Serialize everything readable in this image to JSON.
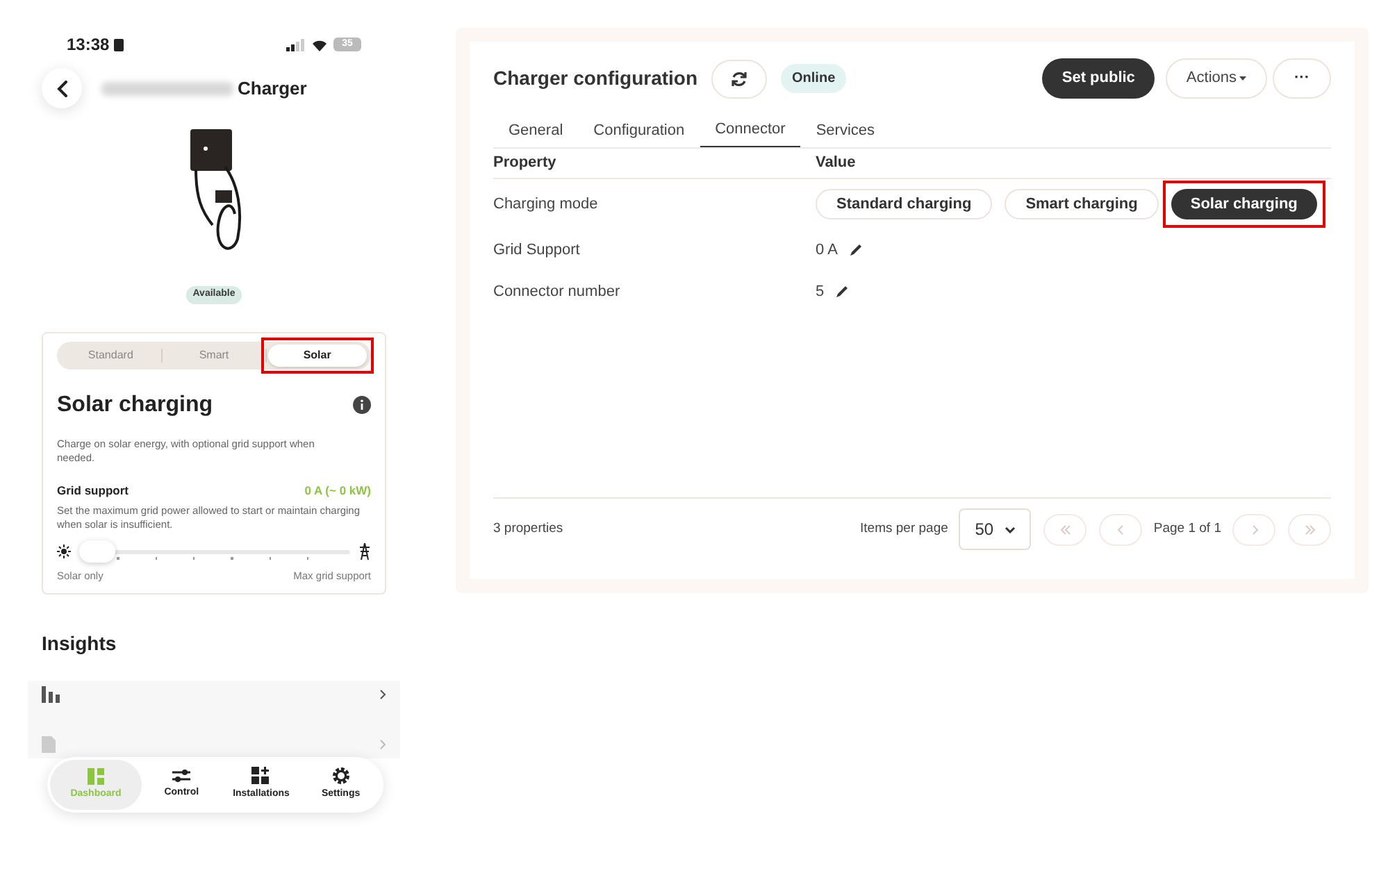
{
  "phone": {
    "status_bar": {
      "time": "13:38",
      "battery": "35"
    },
    "header": {
      "title": "Charger"
    },
    "charger": {
      "status": "Available"
    },
    "mode_tabs": [
      {
        "label": "Standard",
        "selected": false,
        "highlighted": false
      },
      {
        "label": "Smart",
        "selected": false,
        "highlighted": false
      },
      {
        "label": "Solar",
        "selected": true,
        "highlighted": true
      }
    ],
    "mode_card": {
      "title": "Solar charging",
      "description": "Charge on solar energy, with optional grid support when needed.",
      "grid_support": {
        "label": "Grid support",
        "reading": "0 A (~ 0 kW)",
        "hint": "Set the maximum grid power allowed to start or maintain charging when solar is insufficient.",
        "level": 0,
        "min_label": "Solar only",
        "max_label": "Max grid support"
      }
    },
    "insights": {
      "title": "Insights"
    },
    "bottom_nav": [
      {
        "label": "Dashboard",
        "kind": "dashboard",
        "selected": true
      },
      {
        "label": "Control",
        "kind": "control",
        "selected": false
      },
      {
        "label": "Installations",
        "kind": "installations",
        "selected": false
      },
      {
        "label": "Settings",
        "kind": "settings",
        "selected": false
      }
    ]
  },
  "config": {
    "title": "Charger configuration",
    "status": "Online",
    "buttons": {
      "primary": "Set public",
      "actions": "Actions",
      "more": "···"
    },
    "tabs": [
      {
        "label": "General",
        "selected": false
      },
      {
        "label": "Configuration",
        "selected": false
      },
      {
        "label": "Connector",
        "selected": true
      },
      {
        "label": "Services",
        "selected": false
      }
    ],
    "table": {
      "columns": [
        "Property",
        "Value"
      ],
      "rows": [
        {
          "property": "Charging mode",
          "kind": "modes",
          "options": [
            {
              "label": "Standard charging",
              "selected": false,
              "highlighted": false
            },
            {
              "label": "Smart charging",
              "selected": false,
              "highlighted": false
            },
            {
              "label": "Solar charging",
              "selected": true,
              "highlighted": true
            }
          ]
        },
        {
          "property": "Grid Support",
          "kind": "editable",
          "value": "0 A"
        },
        {
          "property": "Connector number",
          "kind": "editable",
          "value": "5"
        }
      ]
    },
    "footer": {
      "count": "3 properties",
      "items_per_page_label": "Items per page",
      "items_per_page": "50",
      "page": "Page 1 of 1"
    }
  }
}
